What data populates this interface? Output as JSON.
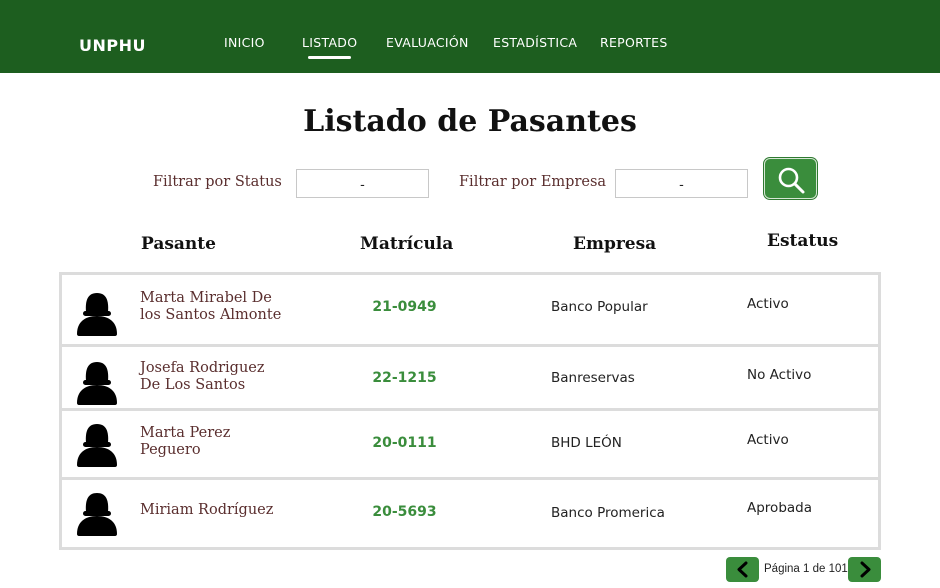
{
  "nav": {
    "brand": "UNPHU",
    "items": [
      {
        "label": "INICIO"
      },
      {
        "label": "LISTADO"
      },
      {
        "label": "EVALUACIÓN"
      },
      {
        "label": "ESTADÍSTICA"
      },
      {
        "label": "REPORTES"
      }
    ],
    "active": "LISTADO"
  },
  "page": {
    "title": "Listado de Pasantes"
  },
  "filters": {
    "status_label": "Filtrar por  Status",
    "status_value": "-",
    "empresa_label": "Filtrar por  Empresa",
    "empresa_value": "-",
    "search_icon": "search-icon"
  },
  "table": {
    "headers": [
      "Pasante",
      "Matrícula",
      "Empresa",
      "Estatus"
    ],
    "rows": [
      {
        "name_line1": "Marta  Mirabel De",
        "name_line2": "los Santos Almonte",
        "matricula": "21-0949",
        "empresa": "Banco Popular",
        "estatus": "Activo"
      },
      {
        "name_line1": "Josefa Rodriguez",
        "name_line2": "De Los Santos",
        "matricula": "22-1215",
        "empresa": "Banreservas",
        "estatus": "No Activo"
      },
      {
        "name_line1": "Marta  Perez",
        "name_line2": "Peguero",
        "matricula": "20-0111",
        "empresa": "BHD LEÓN",
        "estatus": "Activo"
      },
      {
        "name_line1": "Miriam Rodríguez",
        "name_line2": "",
        "matricula": "20-5693",
        "empresa": "Banco Promerica",
        "estatus": "Aprobada"
      }
    ],
    "avatar_icon": "person-silhouette-icon"
  },
  "pagination": {
    "label": "Página 1 de 101",
    "prev_icon": "chevron-left-icon",
    "next_icon": "chevron-right-icon"
  },
  "colors": {
    "nav_bg": "#1d5e1f",
    "accent_green": "#3a8d3c",
    "name_text": "#5a2e2e",
    "border_gray": "#dcdcdc"
  }
}
